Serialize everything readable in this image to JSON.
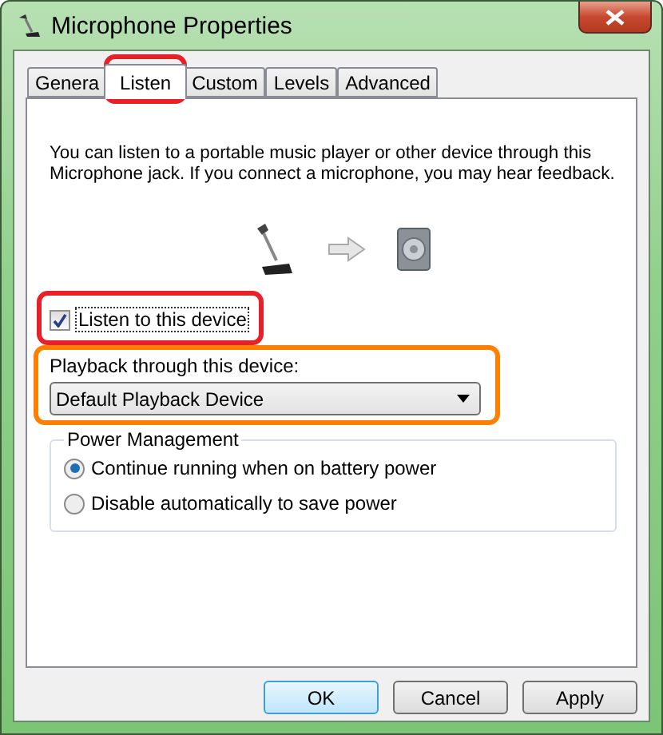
{
  "window": {
    "title": "Microphone Properties"
  },
  "tabs": [
    {
      "label": "Genera",
      "selected": false
    },
    {
      "label": "Listen",
      "selected": true,
      "highlight": {
        "color": "#e8202a"
      }
    },
    {
      "label": "Custom",
      "selected": false
    },
    {
      "label": "Levels",
      "selected": false
    },
    {
      "label": "Advanced",
      "selected": false
    }
  ],
  "description": "You can listen to a portable music player or other device through this Microphone jack.  If you connect a microphone, you may hear feedback.",
  "listen_checkbox": {
    "label": "Listen to this device",
    "checked": true,
    "highlight": {
      "color": "#e8202a"
    }
  },
  "playback": {
    "label": "Playback through this device:",
    "value": "Default Playback Device",
    "highlight": {
      "color": "#ff8000"
    }
  },
  "power_management": {
    "title": "Power Management",
    "options": [
      {
        "label": "Continue running when on battery power",
        "selected": true
      },
      {
        "label": "Disable automatically to save power",
        "selected": false
      }
    ]
  },
  "buttons": [
    {
      "label": "OK",
      "default": true
    },
    {
      "label": "Cancel",
      "default": false
    },
    {
      "label": "Apply",
      "default": false
    }
  ]
}
